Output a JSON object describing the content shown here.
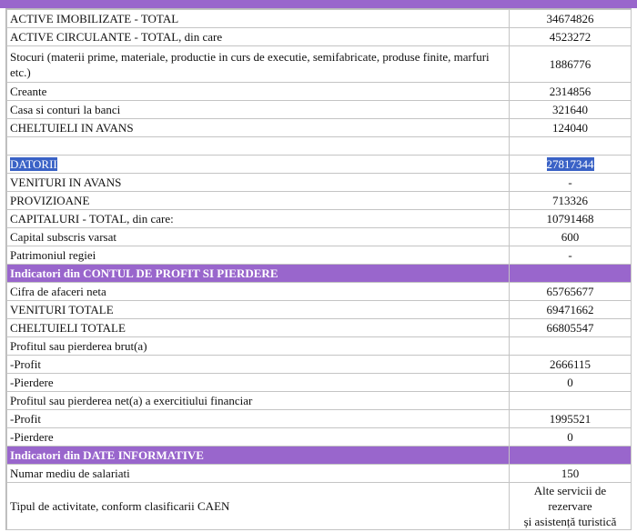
{
  "colors": {
    "section_bg": "#9966cc",
    "highlight": "#3a62c6"
  },
  "rows": [
    {
      "label": "ACTIVE IMOBILIZATE - TOTAL",
      "value": "34674826"
    },
    {
      "label": "ACTIVE CIRCULANTE - TOTAL, din care",
      "value": "4523272"
    },
    {
      "label": "Stocuri (materii prime, materiale, productie in curs de executie, semifabricate, produse finite, marfuri etc.)",
      "value": "1886776"
    },
    {
      "label": "Creante",
      "value": "2314856"
    },
    {
      "label": "Casa si conturi la banci",
      "value": "321640"
    },
    {
      "label": "CHELTUIELI IN AVANS",
      "value": "124040"
    },
    {
      "label": "",
      "value": ""
    },
    {
      "label": "DATORII",
      "value": "27817344"
    },
    {
      "label": "VENITURI IN AVANS",
      "value": "-"
    },
    {
      "label": "PROVIZIOANE",
      "value": "713326"
    },
    {
      "label": "CAPITALURI - TOTAL, din care:",
      "value": "10791468"
    },
    {
      "label": "Capital subscris varsat",
      "value": "600"
    },
    {
      "label": "Patrimoniul regiei",
      "value": "-"
    }
  ],
  "section_profit": {
    "title": "Indicatori din CONTUL DE PROFIT SI PIERDERE"
  },
  "profit_rows": [
    {
      "label": "Cifra de afaceri neta",
      "value": "65765677"
    },
    {
      "label": "VENITURI TOTALE",
      "value": "69471662"
    },
    {
      "label": "CHELTUIELI TOTALE",
      "value": "66805547"
    },
    {
      "label": "Profitul sau pierderea brut(a)",
      "value": ""
    },
    {
      "label": "-Profit",
      "value": "2666115"
    },
    {
      "label": "-Pierdere",
      "value": "0"
    },
    {
      "label": "Profitul sau pierderea net(a) a exercitiului financiar",
      "value": ""
    },
    {
      "label": "-Profit",
      "value": "1995521"
    },
    {
      "label": "-Pierdere",
      "value": "0"
    }
  ],
  "section_info": {
    "title": "Indicatori din DATE INFORMATIVE"
  },
  "info_rows": [
    {
      "label": "Numar mediu de salariati",
      "value": "150"
    },
    {
      "label": "Tipul de activitate, conform clasificarii CAEN",
      "value_line1": "Alte servicii de rezervare",
      "value_line2": "și asistență turistică"
    }
  ]
}
